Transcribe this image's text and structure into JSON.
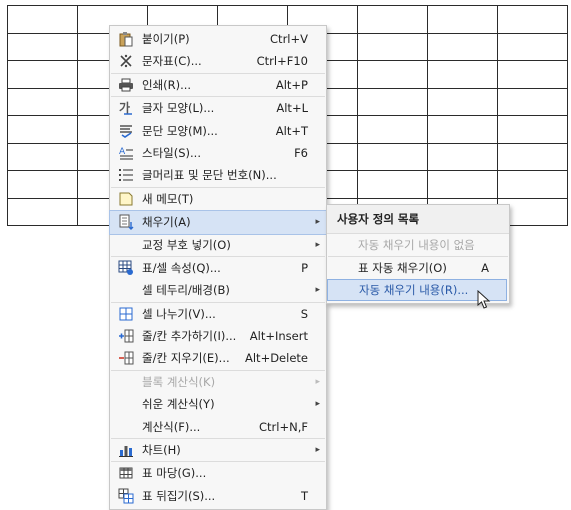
{
  "menu": {
    "items": [
      {
        "label": "붙이기(P)",
        "shortcut": "Ctrl+V",
        "icon": "paste-icon"
      },
      {
        "label": "문자표(C)...",
        "shortcut": "Ctrl+F10",
        "icon": "symbol-icon"
      },
      {
        "label": "인쇄(R)...",
        "shortcut": "Alt+P",
        "icon": "printer-icon"
      },
      {
        "label": "글자 모양(L)...",
        "shortcut": "Alt+L",
        "icon": "char-shape-icon"
      },
      {
        "label": "문단 모양(M)...",
        "shortcut": "Alt+T",
        "icon": "paragraph-shape-icon"
      },
      {
        "label": "스타일(S)...",
        "shortcut": "F6",
        "icon": "style-icon"
      },
      {
        "label": "글머리표 및 문단 번호(N)...",
        "shortcut": "",
        "icon": "bullet-list-icon"
      },
      {
        "label": "새 메모(T)",
        "shortcut": "",
        "icon": "memo-icon"
      },
      {
        "label": "채우기(A)",
        "shortcut": "",
        "icon": "fill-icon"
      },
      {
        "label": "교정 부호 넣기(O)",
        "shortcut": "",
        "icon": ""
      },
      {
        "label": "표/셀 속성(Q)...",
        "shortcut": "P",
        "icon": "table-props-icon"
      },
      {
        "label": "셀 테두리/배경(B)",
        "shortcut": "",
        "icon": ""
      },
      {
        "label": "셀 나누기(V)...",
        "shortcut": "S",
        "icon": "split-cell-icon"
      },
      {
        "label": "줄/칸 추가하기(I)...",
        "shortcut": "Alt+Insert",
        "icon": "insert-row-icon"
      },
      {
        "label": "줄/칸 지우기(E)...",
        "shortcut": "Alt+Delete",
        "icon": "delete-row-icon"
      },
      {
        "label": "블록 계산식(K)",
        "shortcut": "",
        "icon": ""
      },
      {
        "label": "쉬운 계산식(Y)",
        "shortcut": "",
        "icon": ""
      },
      {
        "label": "계산식(F)...",
        "shortcut": "Ctrl+N,F",
        "icon": ""
      },
      {
        "label": "차트(H)",
        "shortcut": "",
        "icon": "chart-icon"
      },
      {
        "label": "표 마당(G)...",
        "shortcut": "",
        "icon": "table-gallery-icon"
      },
      {
        "label": "표 뒤집기(S)...",
        "shortcut": "T",
        "icon": "table-flip-icon"
      }
    ],
    "arrow": "▸"
  },
  "submenu": {
    "title": "사용자 정의 목록",
    "empty_text": "자동 채우기 내용이 없음",
    "auto_fill": {
      "label": "표 자동 채우기(O)",
      "shortcut": "A"
    },
    "auto_fill_content": {
      "label": "자동 채우기 내용(R)..."
    }
  },
  "colors": {
    "highlight": "#d6e3f5",
    "highlight_border": "#8eb1e2",
    "menu_bg": "#f7f7f7"
  }
}
